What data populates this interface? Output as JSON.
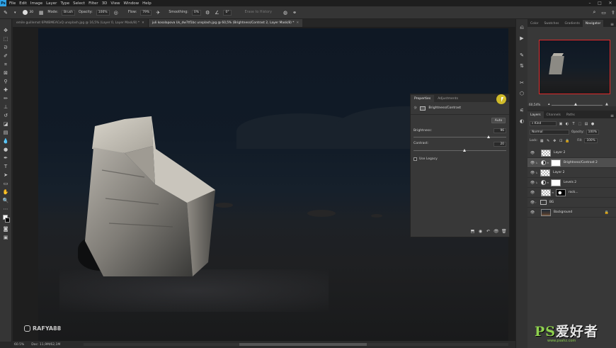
{
  "menu": {
    "items": [
      "File",
      "Edit",
      "Image",
      "Layer",
      "Type",
      "Select",
      "Filter",
      "3D",
      "View",
      "Window",
      "Help"
    ]
  },
  "options": {
    "mode_label": "Mode:",
    "mode_value": "Brush",
    "opacity_label": "Opacity:",
    "opacity_value": "100%",
    "flow_label": "Flow:",
    "flow_value": "79%",
    "smoothing_label": "Smoothing:",
    "smoothing_value": "0%",
    "angle_value": "0°",
    "erase_to_history": "Erase to History",
    "brush_size": "30"
  },
  "tabs": [
    {
      "label": "emile guillemot 6PWBMEACxQ unsplash.jpg @ 16,5% (Layer 0, Layer Mask/8) *",
      "active": false
    },
    {
      "label": "juli kosolapova Us_dw7tf1bc unsplash.jpg @ 60,5% (Brightness/Contrast 2, Layer Mask/8) *",
      "active": true
    }
  ],
  "status": {
    "zoom": "60.5%",
    "doc": "Doc: 11,9M/62,1M"
  },
  "canvas_watermark": "RAFYA88",
  "properties": {
    "tab_properties": "Properties",
    "tab_adjustments": "Adjustments",
    "adjustment_title": "Brightness/Contrast",
    "auto_label": "Auto",
    "brightness_label": "Brightness:",
    "brightness_value": "96",
    "brightness_fraction": 0.81,
    "contrast_label": "Contrast:",
    "contrast_value": "20",
    "contrast_fraction": 0.55,
    "use_legacy_label": "Use Legacy"
  },
  "navigator": {
    "tabs": [
      "Color",
      "Swatches",
      "Gradients",
      "Navigator"
    ],
    "active_tab": "Navigator",
    "zoom": "60,54%"
  },
  "layers_panel": {
    "tabs": [
      "Layers",
      "Channels",
      "Paths"
    ],
    "kind_label": "Kind",
    "blend_mode": "Normal",
    "opacity_label": "Opacity:",
    "opacity_value": "100%",
    "lock_label": "Lock:",
    "fill_label": "Fill:",
    "fill_value": "100%",
    "layers": [
      {
        "name": "Layer 2",
        "thumb": "checker",
        "selected": false,
        "type": "pixel",
        "indent": false
      },
      {
        "name": "Brightness/Contrast 2",
        "thumb": "white",
        "selected": true,
        "type": "adjustment",
        "indent": false
      },
      {
        "name": "Layer 2",
        "thumb": "checker",
        "selected": false,
        "type": "pixel",
        "indent": true
      },
      {
        "name": "Levels 2",
        "thumb": "white",
        "selected": false,
        "type": "adjustment",
        "indent": false
      },
      {
        "name": "rock...",
        "thumb": "checker",
        "selected": false,
        "type": "masked",
        "indent": false
      },
      {
        "name": "BG",
        "thumb": "folder",
        "selected": false,
        "type": "group",
        "indent": false
      },
      {
        "name": "Background",
        "thumb": "bg",
        "selected": false,
        "type": "background",
        "indent": false
      }
    ]
  },
  "site_watermark": {
    "logo_ps": "PS",
    "logo_text": "爱好者",
    "url": "www.psahz.com"
  },
  "colors": {
    "accent_blue": "#2fa3e6",
    "cursor_highlight": "#ebd228",
    "navigator_frame": "#e12a2a",
    "watermark_green": "#8fd14f"
  }
}
